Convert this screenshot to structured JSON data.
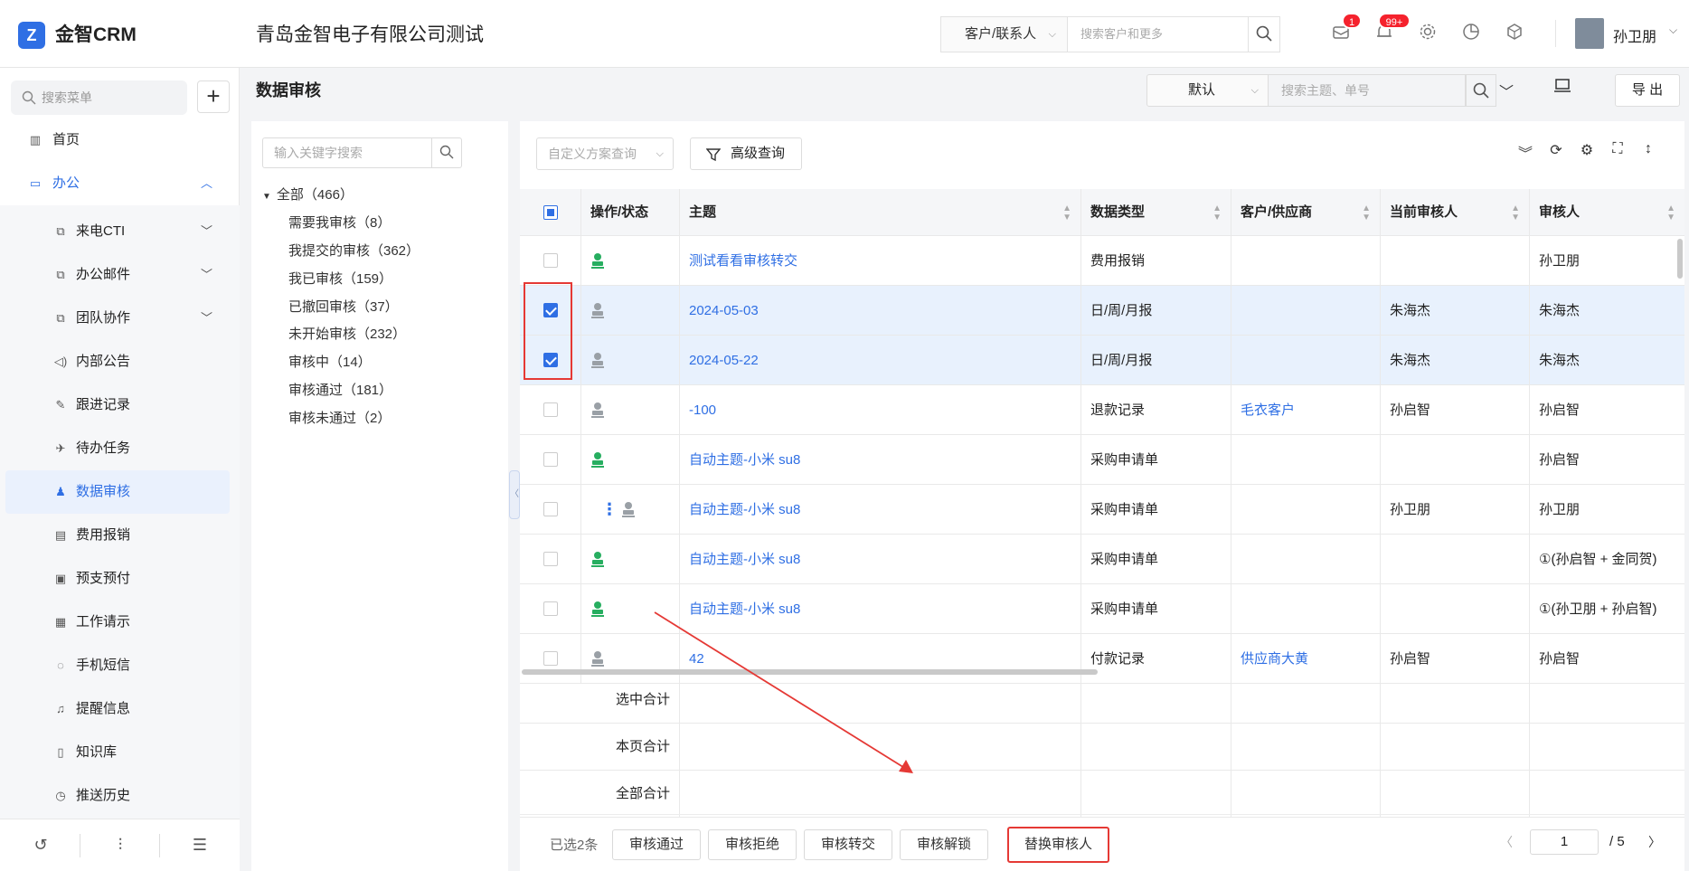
{
  "header": {
    "logo_glyph": "Z",
    "app_name": "金智CRM",
    "company": "青岛金智电子有限公司测试",
    "search_scope": "客户/联系人",
    "search_placeholder": "搜索客户和更多",
    "mail_badge": "1",
    "notice_badge": "99+",
    "username": "孙卫朋"
  },
  "sidebar": {
    "search_placeholder": "搜索菜单",
    "add_label": "+",
    "items": [
      {
        "label": "首页",
        "icon": "home-icon"
      },
      {
        "label": "办公",
        "icon": "office-icon"
      },
      {
        "label": "来电CTI",
        "icon": "copy-icon"
      },
      {
        "label": "办公邮件",
        "icon": "copy-icon"
      },
      {
        "label": "团队协作",
        "icon": "copy-icon"
      },
      {
        "label": "内部公告",
        "icon": "speaker-icon"
      },
      {
        "label": "跟进记录",
        "icon": "edit-icon"
      },
      {
        "label": "待办任务",
        "icon": "pin-icon"
      },
      {
        "label": "数据审核",
        "icon": "stamp-icon"
      },
      {
        "label": "费用报销",
        "icon": "receipt-icon"
      },
      {
        "label": "预支预付",
        "icon": "wallet-icon"
      },
      {
        "label": "工作请示",
        "icon": "doc-icon"
      },
      {
        "label": "手机短信",
        "icon": "sms-icon"
      },
      {
        "label": "提醒信息",
        "icon": "bell-icon"
      },
      {
        "label": "知识库",
        "icon": "book-icon"
      },
      {
        "label": "推送历史",
        "icon": "clock-icon"
      }
    ]
  },
  "page": {
    "title": "数据审核",
    "view": "默认",
    "search_placeholder": "搜索主题、单号",
    "export_label": "导 出"
  },
  "tree": {
    "search_placeholder": "输入关键字搜索",
    "root": "全部（466）",
    "nodes": [
      "需要我审核（8）",
      "我提交的审核（362）",
      "我已审核（159）",
      "已撤回审核（37）",
      "未开始审核（232）",
      "审核中（14）",
      "审核通过（181）",
      "审核未通过（2）"
    ]
  },
  "toolbar": {
    "scheme_placeholder": "自定义方案查询",
    "advanced_label": "高级查询"
  },
  "table": {
    "columns": [
      "操作/状态",
      "主题",
      "数据类型",
      "客户/供应商",
      "当前审核人",
      "审核人"
    ],
    "rows": [
      {
        "status": "green",
        "subject": "测试看看审核转交",
        "type": "费用报销",
        "customer": "",
        "current": "",
        "auditor": "孙卫朋",
        "checked": false
      },
      {
        "status": "gray",
        "subject": "2024-05-03",
        "type": "日/周/月报",
        "customer": "",
        "current": "朱海杰",
        "auditor": "朱海杰",
        "checked": true
      },
      {
        "status": "gray",
        "subject": "2024-05-22",
        "type": "日/周/月报",
        "customer": "",
        "current": "朱海杰",
        "auditor": "朱海杰",
        "checked": true
      },
      {
        "status": "gray",
        "subject": "-100",
        "type": "退款记录",
        "customer": "毛衣客户",
        "current": "孙启智",
        "auditor": "孙启智",
        "checked": false
      },
      {
        "status": "green",
        "subject": "自动主题-小米 su8",
        "type": "采购申请单",
        "customer": "",
        "current": "",
        "auditor": "孙启智",
        "checked": false
      },
      {
        "status": "gray",
        "subject": "自动主题-小米 su8",
        "type": "采购申请单",
        "customer": "",
        "current": "孙卫朋",
        "auditor": "孙卫朋",
        "checked": false,
        "more": "⋮"
      },
      {
        "status": "green",
        "subject": "自动主题-小米 su8",
        "type": "采购申请单",
        "customer": "",
        "current": "",
        "auditor": "①(孙启智 + 金同贺)",
        "checked": false
      },
      {
        "status": "green",
        "subject": "自动主题-小米 su8",
        "type": "采购申请单",
        "customer": "",
        "current": "",
        "auditor": "①(孙卫朋 + 孙启智)",
        "checked": false
      },
      {
        "status": "gray",
        "subject": "42",
        "type": "付款记录",
        "customer": "供应商大黄",
        "current": "孙启智",
        "auditor": "孙启智",
        "checked": false
      }
    ],
    "summary": [
      "选中合计",
      "本页合计",
      "全部合计"
    ]
  },
  "footer": {
    "selected": "已选2条",
    "buttons": [
      "审核通过",
      "审核拒绝",
      "审核转交",
      "审核解锁",
      "替换审核人"
    ],
    "page_current": "1",
    "page_total": "/ 5"
  },
  "colors": {
    "accent": "#2f6fe4",
    "annotation": "#e53935",
    "status_green": "#27ae60",
    "status_gray": "#9aa0a6"
  }
}
